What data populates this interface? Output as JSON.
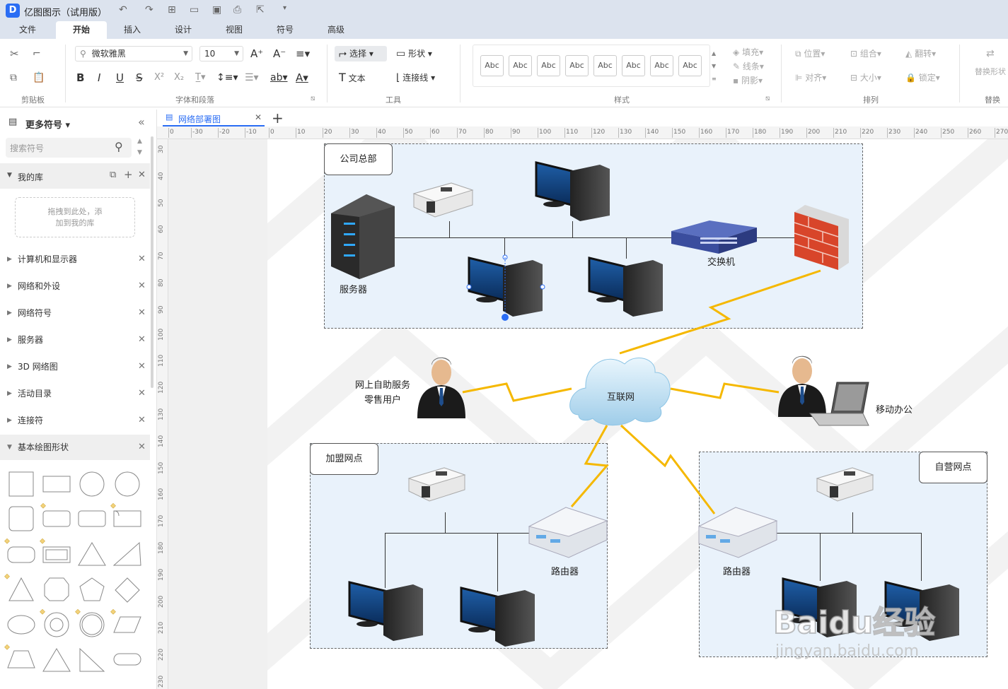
{
  "app": {
    "title": "亿图图示（试用版）"
  },
  "menu": {
    "tabs": [
      "文件",
      "开始",
      "插入",
      "设计",
      "视图",
      "符号",
      "高级"
    ],
    "active": "开始"
  },
  "ribbon": {
    "font_name": "微软雅黑",
    "font_size": "10",
    "select": "选择",
    "shape": "形状",
    "text": "文本",
    "connector": "连接线",
    "styles": [
      "Abc",
      "Abc",
      "Abc",
      "Abc",
      "Abc",
      "Abc",
      "Abc",
      "Abc"
    ],
    "fill": "填充",
    "line": "线条",
    "shadow": "阴影",
    "position": "位置",
    "group": "组合",
    "flip": "翻转",
    "align": "对齐",
    "size": "大小",
    "lock": "锁定",
    "replace_shape": "替换形状",
    "groups": {
      "clipboard": "剪贴板",
      "font": "字体和段落",
      "tools": "工具",
      "style": "样式",
      "arrange": "排列",
      "replace": "替换"
    }
  },
  "sidebar": {
    "header": "更多符号",
    "search_placeholder": "搜索符号",
    "mylib": "我的库",
    "drop_hint_1": "拖拽到此处，添",
    "drop_hint_2": "加到我的库",
    "categories": [
      "计算机和显示器",
      "网络和外设",
      "网络符号",
      "服务器",
      "3D 网络图",
      "活动目录",
      "连接符"
    ],
    "basic": "基本绘图形状"
  },
  "document": {
    "tab": "网络部署图"
  },
  "ruler": {
    "h": [
      "0",
      "-30",
      "-20",
      "-10",
      "0",
      "10",
      "20",
      "30",
      "40",
      "50",
      "60",
      "70",
      "80",
      "90",
      "100",
      "110",
      "120",
      "130",
      "140",
      "150",
      "160",
      "170",
      "180",
      "190",
      "200",
      "210",
      "220",
      "230",
      "240",
      "250",
      "260",
      "270"
    ],
    "v": [
      "30",
      "40",
      "50",
      "60",
      "70",
      "80",
      "90",
      "100",
      "110",
      "120",
      "130",
      "140",
      "150",
      "160",
      "170",
      "180",
      "190",
      "200",
      "210",
      "220",
      "230"
    ]
  },
  "diagram": {
    "hq": "公司总部",
    "server": "服务器",
    "switch": "交换机",
    "internet": "互联网",
    "online_user_1": "网上自助服务",
    "online_user_2": "零售用户",
    "mobile": "移动办公",
    "franchise": "加盟网点",
    "own": "自营网点",
    "router1": "路由器",
    "router2": "路由器"
  },
  "watermark": {
    "brand": "Baidu经验",
    "url": "jingyan.baidu.com"
  }
}
